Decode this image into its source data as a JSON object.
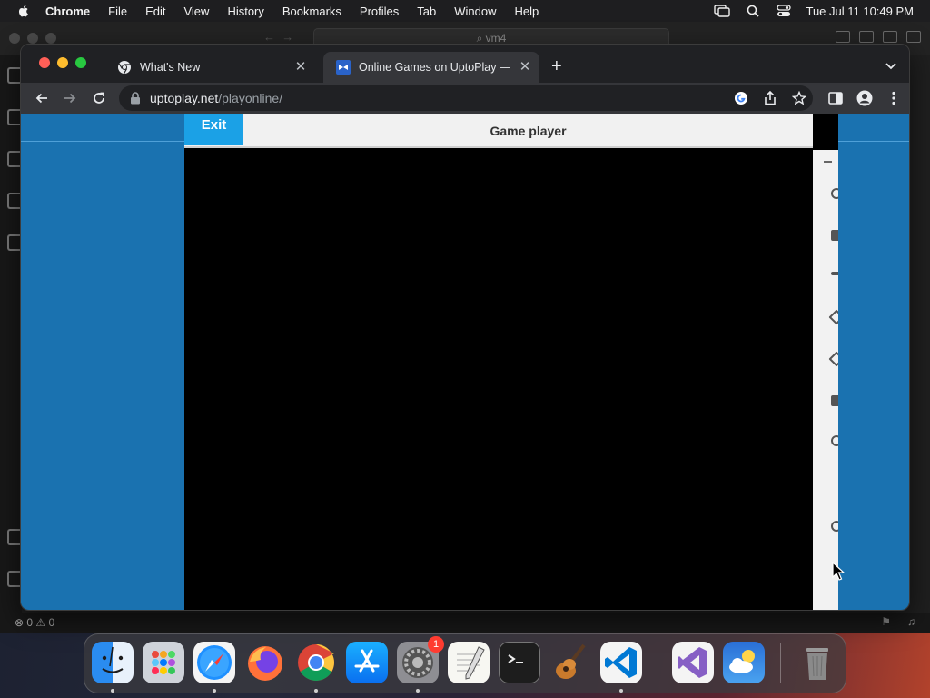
{
  "menubar": {
    "app": "Chrome",
    "items": [
      "File",
      "Edit",
      "View",
      "History",
      "Bookmarks",
      "Profiles",
      "Tab",
      "Window",
      "Help"
    ],
    "clock": "Tue Jul 11  10:49 PM"
  },
  "vscode": {
    "command_center": "⌕ vm4",
    "status_errors": "⊗ 0 ⚠ 0"
  },
  "chrome": {
    "tabs": [
      {
        "title": "What's New",
        "active": false
      },
      {
        "title": "Online Games on UptoPlay — P",
        "active": true
      }
    ],
    "url_host": "uptoplay.net",
    "url_path": "/playonline/"
  },
  "player": {
    "exit_label": "Exit",
    "title": "Game player"
  },
  "dock": {
    "apps": [
      "finder",
      "launchpad",
      "safari",
      "firefox",
      "chrome",
      "app-store",
      "system-settings",
      "textedit",
      "terminal",
      "garageband",
      "vscode",
      "visual-studio",
      "weather",
      "trash"
    ],
    "settings_badge": "1"
  },
  "colors": {
    "page_bg": "#1a72b0",
    "exit_bg": "#1ba1e6",
    "chrome_frame": "#202124",
    "toolbar": "#35363a"
  }
}
